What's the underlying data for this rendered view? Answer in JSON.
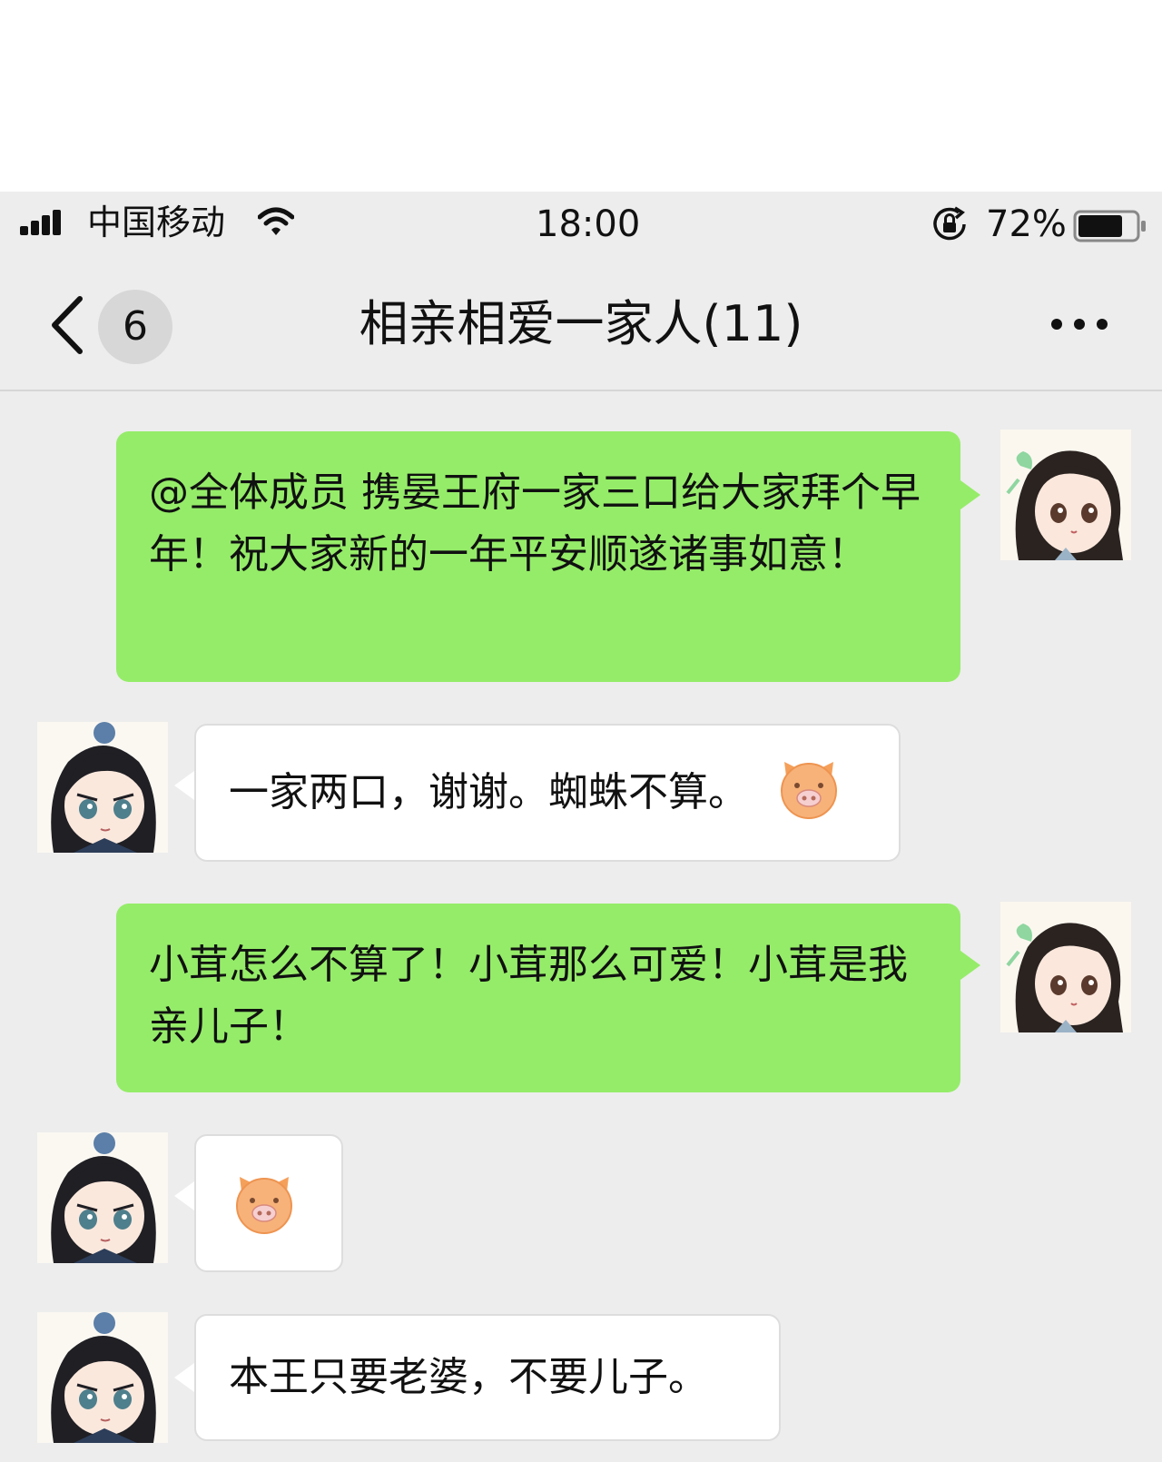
{
  "status_bar": {
    "carrier": "中国移动",
    "time": "18:00",
    "battery_percent": "72%",
    "battery_level": 0.72,
    "icons": [
      "signal-icon",
      "wifi-icon",
      "rotation-lock-icon",
      "battery-icon"
    ]
  },
  "nav": {
    "back_icon": "chevron-left-icon",
    "unread_count": "6",
    "title": "相亲相爱一家人(11)",
    "more_icon": "ellipsis-icon"
  },
  "messages": [
    {
      "side": "right",
      "text": "@全体成员 携晏王府一家三口给大家拜个早年！祝大家新的一年平安顺遂诸事如意！"
    },
    {
      "side": "left",
      "text": "一家两口，谢谢。蜘蛛不算。",
      "emoji": "pig-face-icon"
    },
    {
      "side": "right",
      "text": "小茸怎么不算了！小茸那么可爱！小茸是我亲儿子！"
    },
    {
      "side": "left",
      "emoji": "pig-face-icon"
    },
    {
      "side": "left",
      "text": "本王只要老婆，不要儿子。"
    }
  ],
  "colors": {
    "chat_background": "#ededed",
    "self_bubble": "#95ec69",
    "other_bubble": "#ffffff",
    "pig_emoji": "#f5a05a"
  }
}
